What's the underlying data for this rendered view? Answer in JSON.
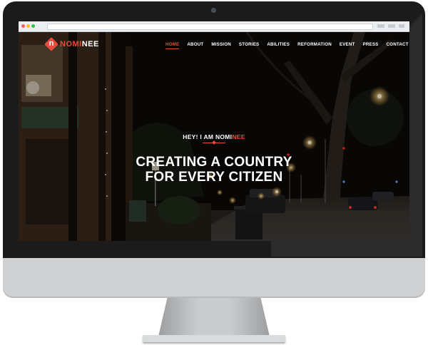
{
  "brand": {
    "prefix": "NOMI",
    "suffix": "NEE",
    "mark_letter": "n"
  },
  "nav": {
    "items": [
      "HOME",
      "ABOUT",
      "MISSION",
      "STORIES",
      "ABILITIES",
      "REFORMATION",
      "EVENT",
      "PRESS",
      "CONTACT"
    ],
    "active": "HOME"
  },
  "hero": {
    "kicker_prefix": "HEY! I AM ",
    "kicker_name_a": "NOMI",
    "kicker_name_b": "NEE",
    "headline_line1": "CREATING A COUNTRY",
    "headline_line2": "FOR EVERY CITIZEN"
  },
  "colors": {
    "accent": "#e74c3c",
    "bezel": "#1b1b1c",
    "chin": "#cfd1d3"
  }
}
